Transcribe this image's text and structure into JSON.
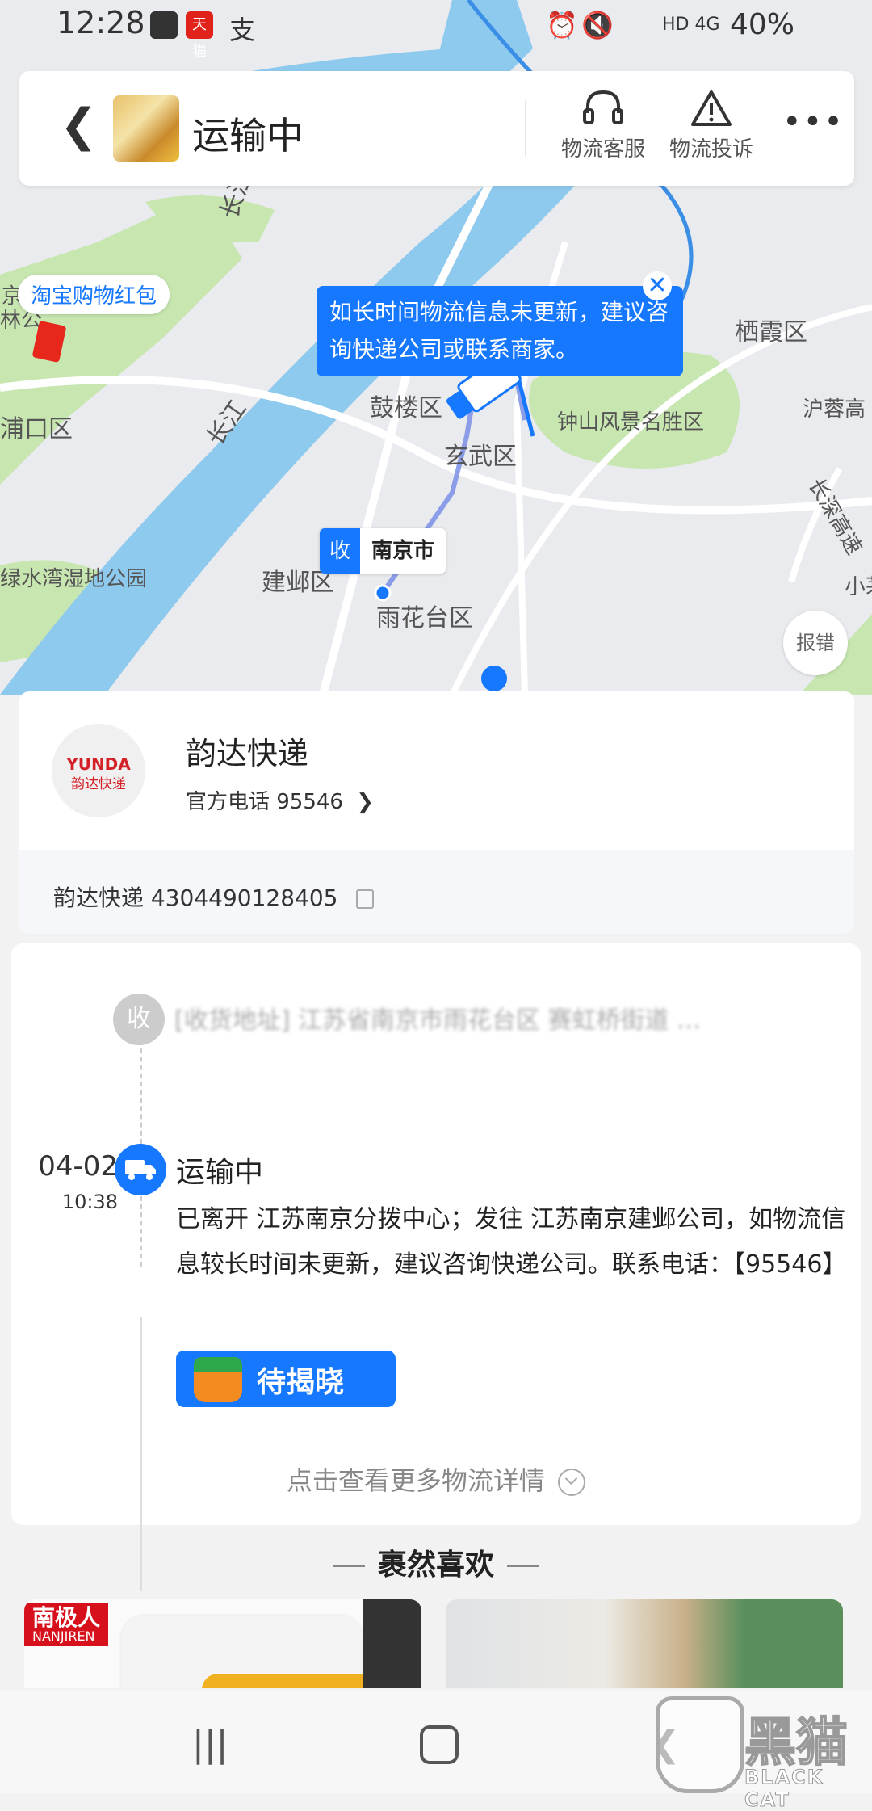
{
  "status_bar": {
    "time": "12:28",
    "app_icon_tmall": "天猫",
    "app_icon_alipay": "支",
    "network": "HD 4G",
    "battery": "40%"
  },
  "header": {
    "title": "运输中",
    "actions": [
      {
        "label": "物流客服",
        "icon": "headset-icon"
      },
      {
        "label": "物流投诉",
        "icon": "warning-icon"
      }
    ],
    "more_icon": "more-icon"
  },
  "map": {
    "labels": [
      "长江",
      "长江",
      "栖霞区",
      "鼓楼区",
      "钟山风景名胜区",
      "沪蓉高",
      "浦口区",
      "玄武区",
      "长深高速",
      "绿水湾湿地公园",
      "建邺区",
      "雨花台区",
      "小茅",
      "京",
      "林公"
    ],
    "red_packet_label": "淘宝购物红包",
    "tip_text": "如长时间物流信息未更新，建议咨询快递公司或联系商家。",
    "receive_tag": "收",
    "receive_city": "南京市",
    "report_label": "报错"
  },
  "courier": {
    "logo_en": "YUNDA",
    "logo_cn": "韵达快递",
    "name": "韵达快递",
    "phone_label": "官方电话 95546",
    "tracking": "韵达快递 4304490128405"
  },
  "timeline": {
    "receive_node": "收",
    "address": "[收货地址] 江苏省南京市雨花台区 赛虹桥街道 …",
    "current": {
      "date": "04-02",
      "time": "10:38",
      "title": "运输中",
      "description": "已离开 江苏南京分拨中心；发往 江苏南京建邺公司，如物流信息较长时间未更新，建议咨询快递公司。联系电话：【95546】",
      "reveal_button": "待揭晓"
    },
    "more_link": "点击查看更多物流详情"
  },
  "recommend": {
    "title": "裹然喜欢",
    "product1_brand": "南极人",
    "product1_brand_en": "NANJIREN"
  },
  "watermark": {
    "main": "黑猫",
    "sub": "BLACK CAT"
  },
  "colors": {
    "accent": "#1677ff",
    "brand_red": "#d42027",
    "water": "#8ec9ee"
  }
}
